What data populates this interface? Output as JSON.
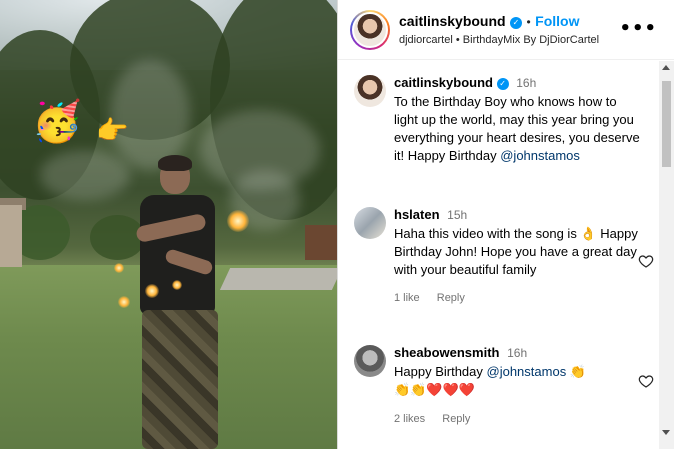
{
  "post": {
    "author": "caitlinskybound",
    "follow_label": "Follow",
    "separator": "•",
    "audio_credit": "djdiorcartel",
    "audio_track": "BirthdayMix By DjDiorCartel",
    "more_label": "•••"
  },
  "media": {
    "stickers": [
      "🥳",
      "👉"
    ]
  },
  "comments": [
    {
      "username": "caitlinskybound",
      "verified": true,
      "time": "16h",
      "text": "To the Birthday Boy who knows how to light up the world, may this year bring you everything your heart desires, you deserve it! Happy Birthday",
      "mention": "@johnstamos"
    },
    {
      "username": "hslaten",
      "time": "15h",
      "text": "Haha this video with the song is 👌 Happy Birthday John! Hope you have a great day with your beautiful family",
      "likes": "1 like",
      "reply": "Reply"
    },
    {
      "username": "sheabowensmith",
      "time": "16h",
      "text_prefix": "Happy Birthday",
      "mention": "@johnstamos",
      "text_suffix": "👏",
      "emoji_line": "👏👏❤️❤️❤️",
      "likes": "2 likes",
      "reply": "Reply"
    }
  ],
  "colors": {
    "accent": "#0095f6",
    "mention": "#00376b",
    "muted": "#737373"
  },
  "icons": {
    "verified": "verified-badge-icon",
    "heart": "heart-outline-icon",
    "more": "more-options-icon"
  }
}
